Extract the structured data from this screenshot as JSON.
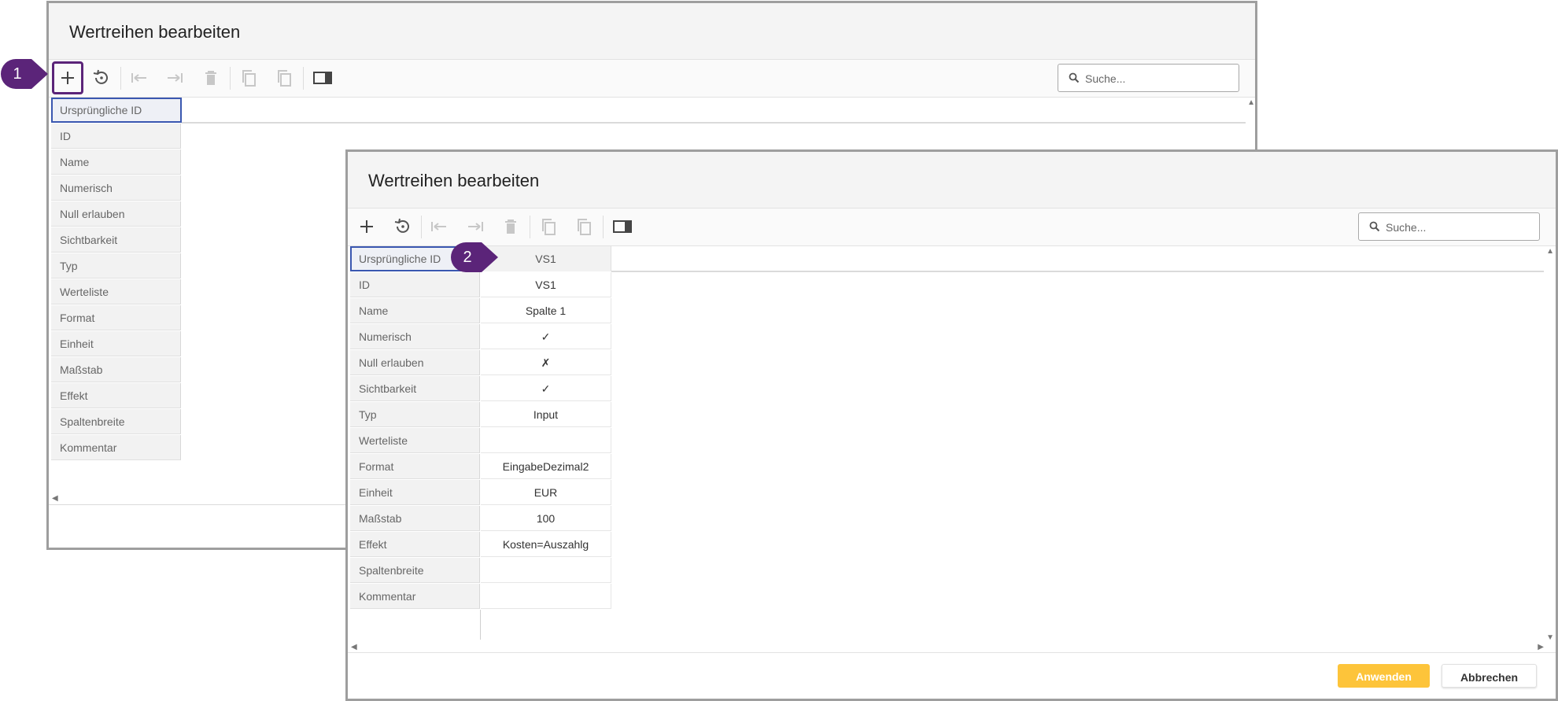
{
  "dialog_back": {
    "title": "Wertreihen bearbeiten",
    "search_placeholder": "Suche...",
    "header_label": "Ursprüngliche ID",
    "rows": [
      "ID",
      "Name",
      "Numerisch",
      "Null erlauben",
      "Sichtbarkeit",
      "Typ",
      "Werteliste",
      "Format",
      "Einheit",
      "Maßstab",
      "Effekt",
      "Spaltenbreite",
      "Kommentar"
    ]
  },
  "dialog_front": {
    "title": "Wertreihen bearbeiten",
    "search_placeholder": "Suche...",
    "header_label": "Ursprüngliche ID",
    "header_value": "VS1",
    "rows": [
      {
        "label": "ID",
        "value": "VS1"
      },
      {
        "label": "Name",
        "value": "Spalte 1"
      },
      {
        "label": "Numerisch",
        "value": "✓"
      },
      {
        "label": "Null erlauben",
        "value": "✗"
      },
      {
        "label": "Sichtbarkeit",
        "value": "✓"
      },
      {
        "label": "Typ",
        "value": "Input"
      },
      {
        "label": "Werteliste",
        "value": ""
      },
      {
        "label": "Format",
        "value": "EingabeDezimal2"
      },
      {
        "label": "Einheit",
        "value": "EUR"
      },
      {
        "label": "Maßstab",
        "value": "100"
      },
      {
        "label": "Effekt",
        "value": "Kosten=Auszahlg"
      },
      {
        "label": "Spaltenbreite",
        "value": ""
      },
      {
        "label": "Kommentar",
        "value": ""
      }
    ],
    "apply_label": "Anwenden",
    "cancel_label": "Abbrechen"
  },
  "callouts": {
    "one": "1",
    "two": "2"
  },
  "colors": {
    "callout": "#5b2479",
    "apply": "#fdc43a",
    "header_border": "#3a57b0"
  },
  "icons": [
    "plus-icon",
    "undo-icon",
    "move-first-icon",
    "move-last-icon",
    "trash-icon",
    "copy-icon",
    "paste-icon",
    "panel-icon",
    "search-icon"
  ]
}
